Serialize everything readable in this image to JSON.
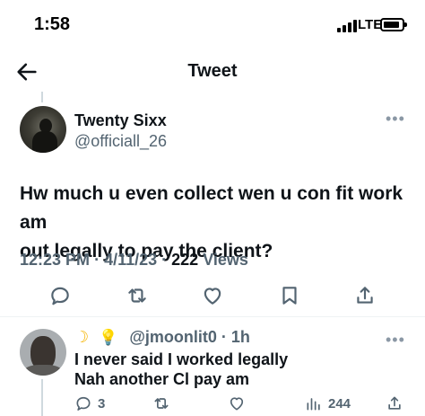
{
  "status_bar": {
    "time": "1:58",
    "network": "LTE"
  },
  "header": {
    "title": "Tweet"
  },
  "tweet": {
    "author_name": "Twenty Sixx",
    "author_handle": "@officiall_26",
    "text_line1": "Hw much u even collect wen u con fit work am",
    "text_line2": "out legally to pay the client?",
    "time": "12:23 PM",
    "date": "4/11/23",
    "views": "222",
    "views_label": "Views"
  },
  "reply": {
    "emoji1": "☽",
    "emoji2": "💡",
    "handle": "@jmoonlit0",
    "age": "1h",
    "text_line1": "I never said I worked legally",
    "text_line2": "Nah another Cl pay am",
    "reply_count": "3",
    "view_count": "244"
  },
  "colors": {
    "text": "#0f1419",
    "muted": "#536471",
    "accent": "#1d9bf0"
  },
  "icons": [
    "back-arrow-icon",
    "more-icon",
    "reply-icon",
    "retweet-icon",
    "like-icon",
    "bookmark-icon",
    "share-icon",
    "views-icon"
  ]
}
